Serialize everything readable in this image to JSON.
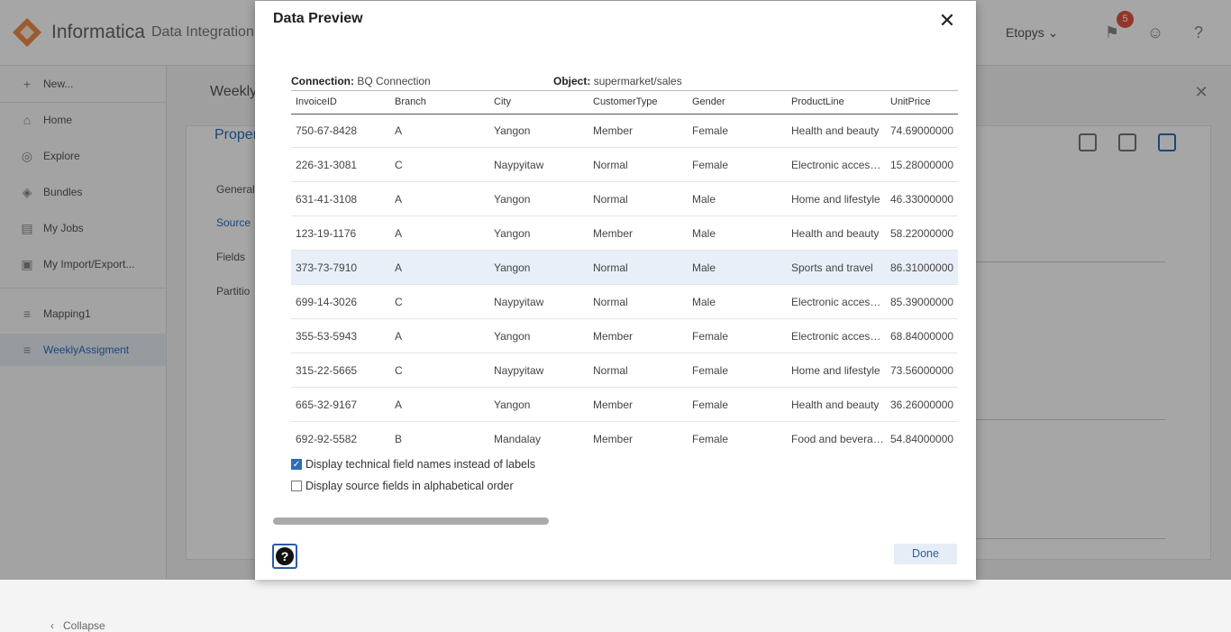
{
  "app": {
    "brand": "Informatica",
    "product": "Data Integration",
    "org": "Etopys",
    "notifications": "5"
  },
  "sidebar": {
    "items": [
      {
        "label": "New...",
        "icon": "plus-icon"
      },
      {
        "label": "Home",
        "icon": "home-icon"
      },
      {
        "label": "Explore",
        "icon": "compass-icon"
      },
      {
        "label": "Bundles",
        "icon": "cube-icon"
      },
      {
        "label": "My Jobs",
        "icon": "jobs-icon"
      },
      {
        "label": "My Import/Export...",
        "icon": "import-export-icon"
      },
      {
        "label": "Mapping1",
        "icon": "mapping-icon"
      },
      {
        "label": "WeeklyAssigment",
        "icon": "mapping-icon"
      }
    ],
    "collapse": "Collapse"
  },
  "background": {
    "title": "Weekly",
    "tab": "Proper",
    "sections": [
      "General",
      "Source",
      "Fields",
      "Partitio"
    ]
  },
  "dialog": {
    "title": "Data Preview",
    "connection_label": "Connection:",
    "connection_value": "BQ Connection",
    "object_label": "Object:",
    "object_value": "supermarket/sales",
    "columns": [
      "InvoiceID",
      "Branch",
      "City",
      "CustomerType",
      "Gender",
      "ProductLine",
      "UnitPrice"
    ],
    "rows": [
      [
        "750-67-8428",
        "A",
        "Yangon",
        "Member",
        "Female",
        "Health and beauty",
        "74.69000000"
      ],
      [
        "226-31-3081",
        "C",
        "Naypyitaw",
        "Normal",
        "Female",
        "Electronic accessories",
        "15.28000000"
      ],
      [
        "631-41-3108",
        "A",
        "Yangon",
        "Normal",
        "Male",
        "Home and lifestyle",
        "46.33000000"
      ],
      [
        "123-19-1176",
        "A",
        "Yangon",
        "Member",
        "Male",
        "Health and beauty",
        "58.22000000"
      ],
      [
        "373-73-7910",
        "A",
        "Yangon",
        "Normal",
        "Male",
        "Sports and travel",
        "86.31000000"
      ],
      [
        "699-14-3026",
        "C",
        "Naypyitaw",
        "Normal",
        "Male",
        "Electronic accessories",
        "85.39000000"
      ],
      [
        "355-53-5943",
        "A",
        "Yangon",
        "Member",
        "Female",
        "Electronic accessories",
        "68.84000000"
      ],
      [
        "315-22-5665",
        "C",
        "Naypyitaw",
        "Normal",
        "Female",
        "Home and lifestyle",
        "73.56000000"
      ],
      [
        "665-32-9167",
        "A",
        "Yangon",
        "Member",
        "Female",
        "Health and beauty",
        "36.26000000"
      ],
      [
        "692-92-5582",
        "B",
        "Mandalay",
        "Member",
        "Female",
        "Food and beverages",
        "54.84000000"
      ]
    ],
    "selected_row": 4,
    "checkbox_technical": "Display technical field names instead of labels",
    "checkbox_technical_checked": true,
    "checkbox_alpha": "Display source fields in alphabetical order",
    "checkbox_alpha_checked": false,
    "help": "?",
    "done": "Done"
  }
}
